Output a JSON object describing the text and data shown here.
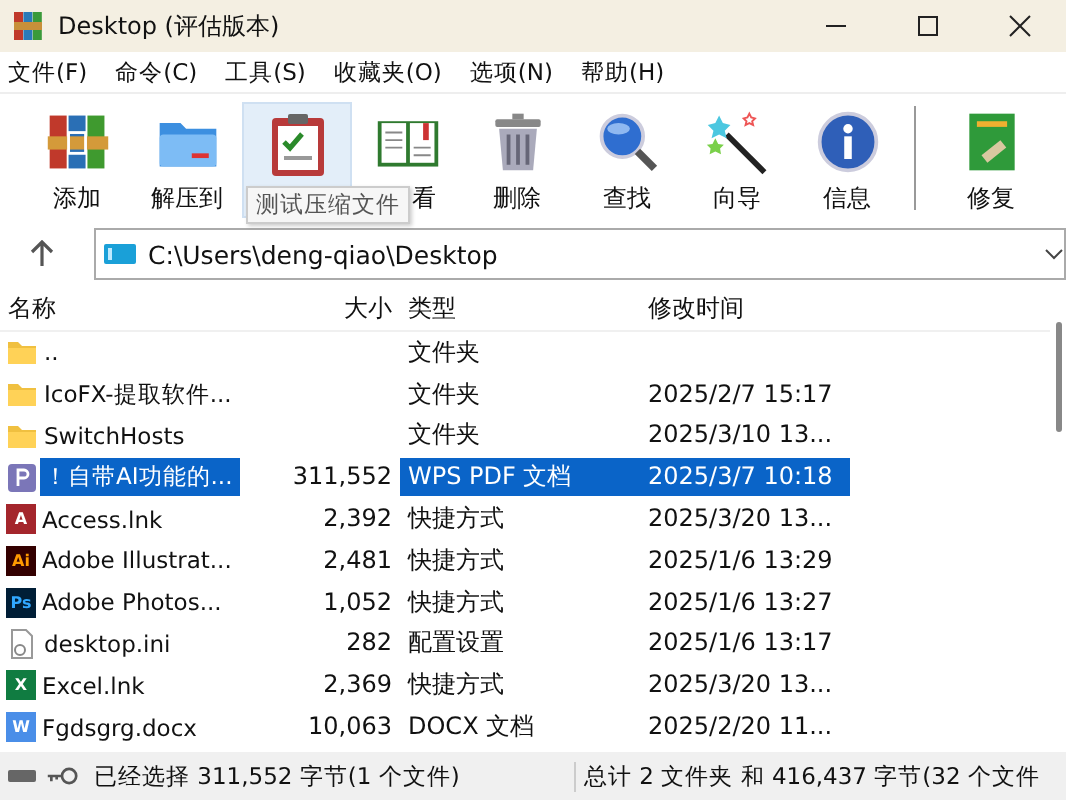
{
  "window": {
    "title": "Desktop (评估版本)"
  },
  "menu": [
    "文件(F)",
    "命令(C)",
    "工具(S)",
    "收藏夹(O)",
    "选项(N)",
    "帮助(H)"
  ],
  "toolbar": [
    {
      "kind": "add",
      "label": "添加",
      "hovered": false
    },
    {
      "kind": "extract",
      "label": "解压到",
      "hovered": false
    },
    {
      "kind": "test",
      "hovered": true
    },
    {
      "kind": "view",
      "label": "看",
      "hovered": false
    },
    {
      "kind": "delete",
      "label": "删除",
      "hovered": false
    },
    {
      "kind": "find",
      "label": "查找",
      "hovered": false
    },
    {
      "kind": "wizard",
      "label": "向导",
      "hovered": false
    },
    {
      "kind": "info",
      "label": "信息",
      "hovered": false
    },
    {
      "kind": "repair",
      "label": "修复",
      "hovered": false
    }
  ],
  "tooltip": "测试压缩文件",
  "address": "C:\\Users\\deng-qiao\\Desktop",
  "columns": [
    "名称",
    "大小",
    "类型",
    "修改时间"
  ],
  "rows": [
    {
      "kind": "folder",
      "name": "..",
      "type": "文件夹",
      "selected": false
    },
    {
      "kind": "folder",
      "name": "IcoFX-提取软件...",
      "type": "文件夹",
      "modified": "2025/2/7 15:17",
      "selected": false
    },
    {
      "kind": "folder",
      "name": "SwitchHosts",
      "type": "文件夹",
      "modified": "2025/3/10 13...",
      "selected": false
    },
    {
      "kind": "pdf",
      "name": "！自带AI功能的...",
      "size": "311,552",
      "type": "WPS PDF 文档",
      "modified": "2025/3/7 10:18",
      "selected": true
    },
    {
      "kind": "access",
      "badge": "A",
      "name": "Access.lnk",
      "size": "2,392",
      "type": "快捷方式",
      "modified": "2025/3/20 13...",
      "selected": false
    },
    {
      "kind": "ai",
      "badge": "Ai",
      "name": "Adobe Illustrat...",
      "size": "2,481",
      "type": "快捷方式",
      "modified": "2025/1/6 13:29",
      "selected": false
    },
    {
      "kind": "ps",
      "badge": "Ps",
      "name": "Adobe Photos...",
      "size": "1,052",
      "type": "快捷方式",
      "modified": "2025/1/6 13:27",
      "selected": false
    },
    {
      "kind": "ini",
      "name": "desktop.ini",
      "size": "282",
      "type": "配置设置",
      "modified": "2025/1/6 13:17",
      "selected": false
    },
    {
      "kind": "excel",
      "badge": "X",
      "name": "Excel.lnk",
      "size": "2,369",
      "type": "快捷方式",
      "modified": "2025/3/20 13...",
      "selected": false
    },
    {
      "kind": "word",
      "badge": "W",
      "name": "Fgdsgrg.docx",
      "size": "10,063",
      "type": "DOCX 文档",
      "modified": "2025/2/20 11...",
      "selected": false
    }
  ],
  "status_bar": {
    "left": "已经选择 311,552 字节(1 个文件)",
    "right": "总计 2 文件夹 和 416,437 字节(32 个文件"
  }
}
